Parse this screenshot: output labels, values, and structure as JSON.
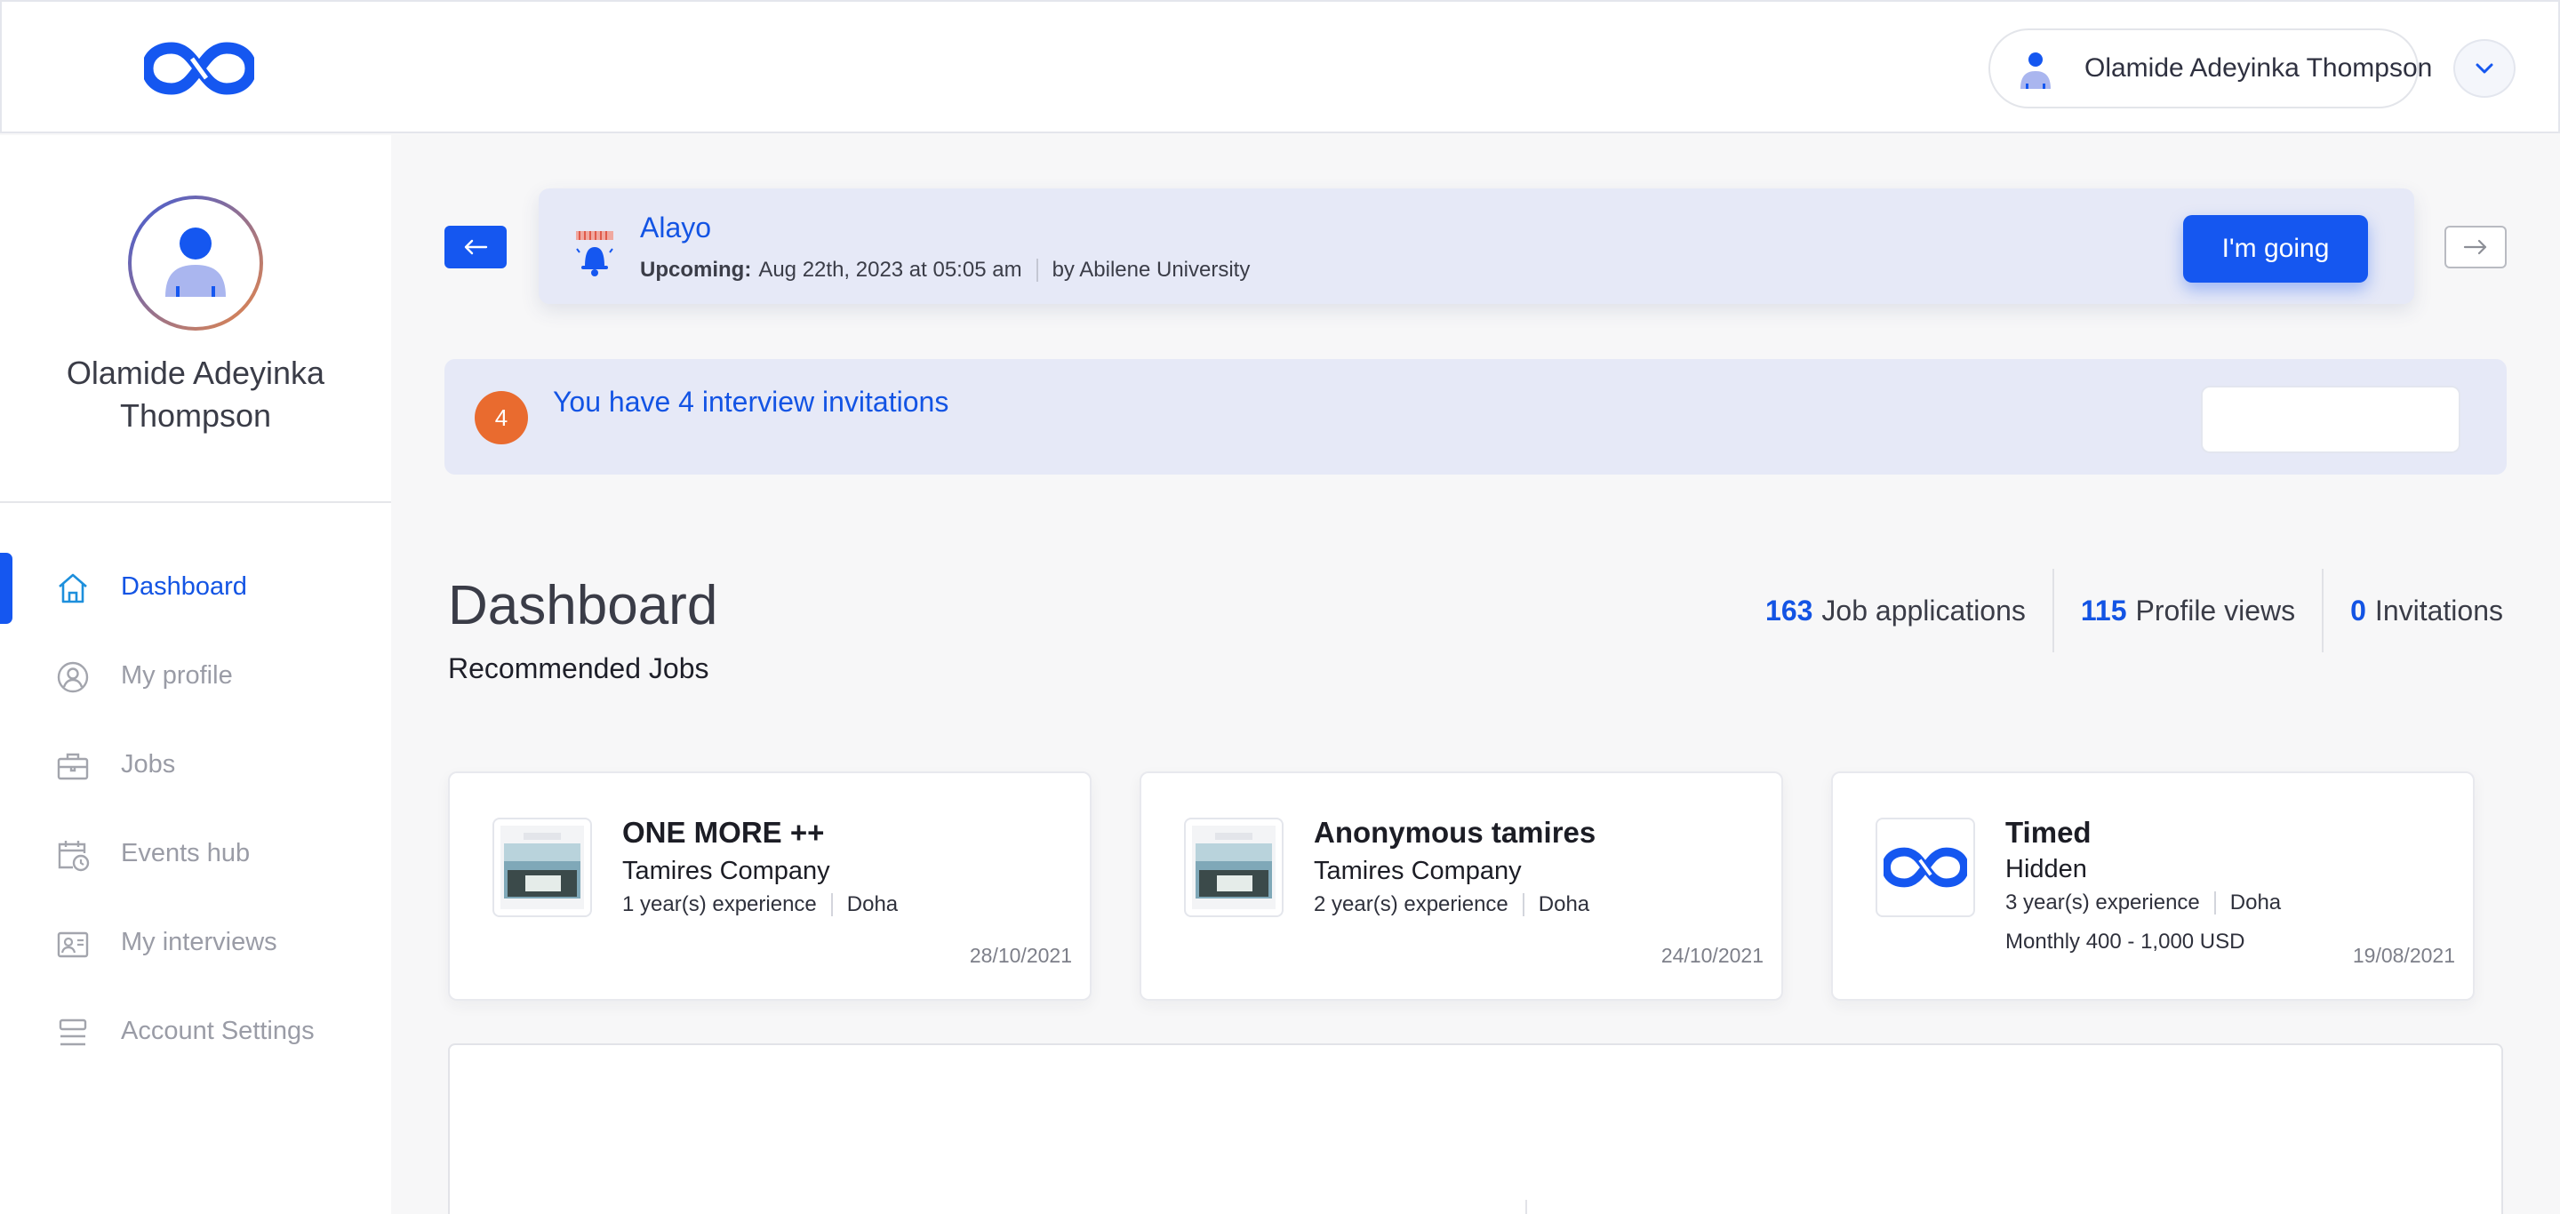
{
  "header": {
    "user_name": "Olamide Adeyinka Thompson"
  },
  "sidebar": {
    "profile_name": "Olamide Adeyinka Thompson",
    "items": [
      {
        "label": "Dashboard",
        "icon": "home-icon",
        "active": true
      },
      {
        "label": "My profile",
        "icon": "user-circle-icon",
        "active": false
      },
      {
        "label": "Jobs",
        "icon": "briefcase-icon",
        "active": false
      },
      {
        "label": "Events hub",
        "icon": "calendar-clock-icon",
        "active": false
      },
      {
        "label": "My interviews",
        "icon": "interview-icon",
        "active": false
      },
      {
        "label": "Account Settings",
        "icon": "settings-list-icon",
        "active": false
      }
    ]
  },
  "event": {
    "title": "Alayo",
    "status_label": "Upcoming:",
    "date": "Aug 22th, 2023 at 05:05 am",
    "organizer": "by Abilene University",
    "button_label": "I'm going"
  },
  "invitations": {
    "count": "4",
    "text": "You have 4 interview invitations"
  },
  "dashboard": {
    "title": "Dashboard",
    "recommended_title": "Recommended Jobs",
    "stats": [
      {
        "value": "163",
        "label": "Job applications"
      },
      {
        "value": "115",
        "label": "Profile views"
      },
      {
        "value": "0",
        "label": "Invitations"
      }
    ]
  },
  "jobs": [
    {
      "title": "ONE MORE ++",
      "company": "Tamires Company",
      "experience": "1 year(s) experience",
      "location": "Doha",
      "salary": "",
      "date": "28/10/2021",
      "thumb": "photo"
    },
    {
      "title": "Anonymous tamires",
      "company": "Tamires Company",
      "experience": "2 year(s) experience",
      "location": "Doha",
      "salary": "",
      "date": "24/10/2021",
      "thumb": "photo"
    },
    {
      "title": "Timed",
      "company": "Hidden",
      "experience": "3 year(s) experience",
      "location": "Doha",
      "salary": "Monthly 400 - 1,000 USD",
      "date": "19/08/2021",
      "thumb": "logo"
    }
  ],
  "colors": {
    "accent": "#1557f0",
    "banner_bg": "#e6e9f7",
    "badge": "#e96b2f"
  }
}
